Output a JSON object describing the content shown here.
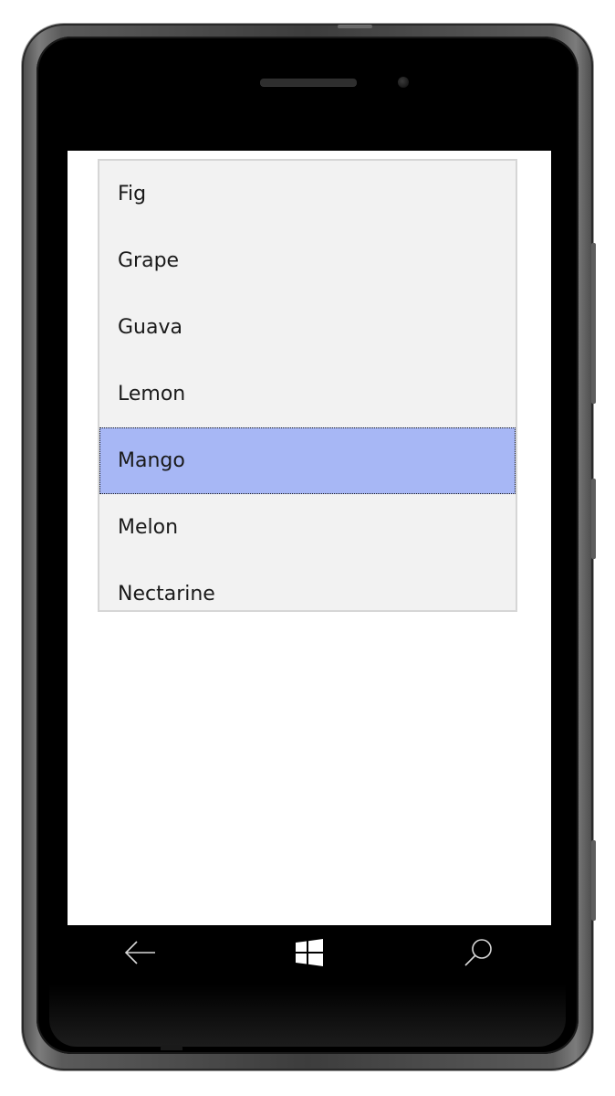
{
  "listbox": {
    "items": [
      "Fig",
      "Grape",
      "Guava",
      "Lemon",
      "Mango",
      "Melon",
      "Nectarine"
    ],
    "selected_index": 4,
    "selected_color": "#a7b7f5",
    "background_color": "#f2f2f2"
  },
  "nav": {
    "back_icon": "back-arrow-icon",
    "start_icon": "windows-logo-icon",
    "search_icon": "search-icon"
  }
}
